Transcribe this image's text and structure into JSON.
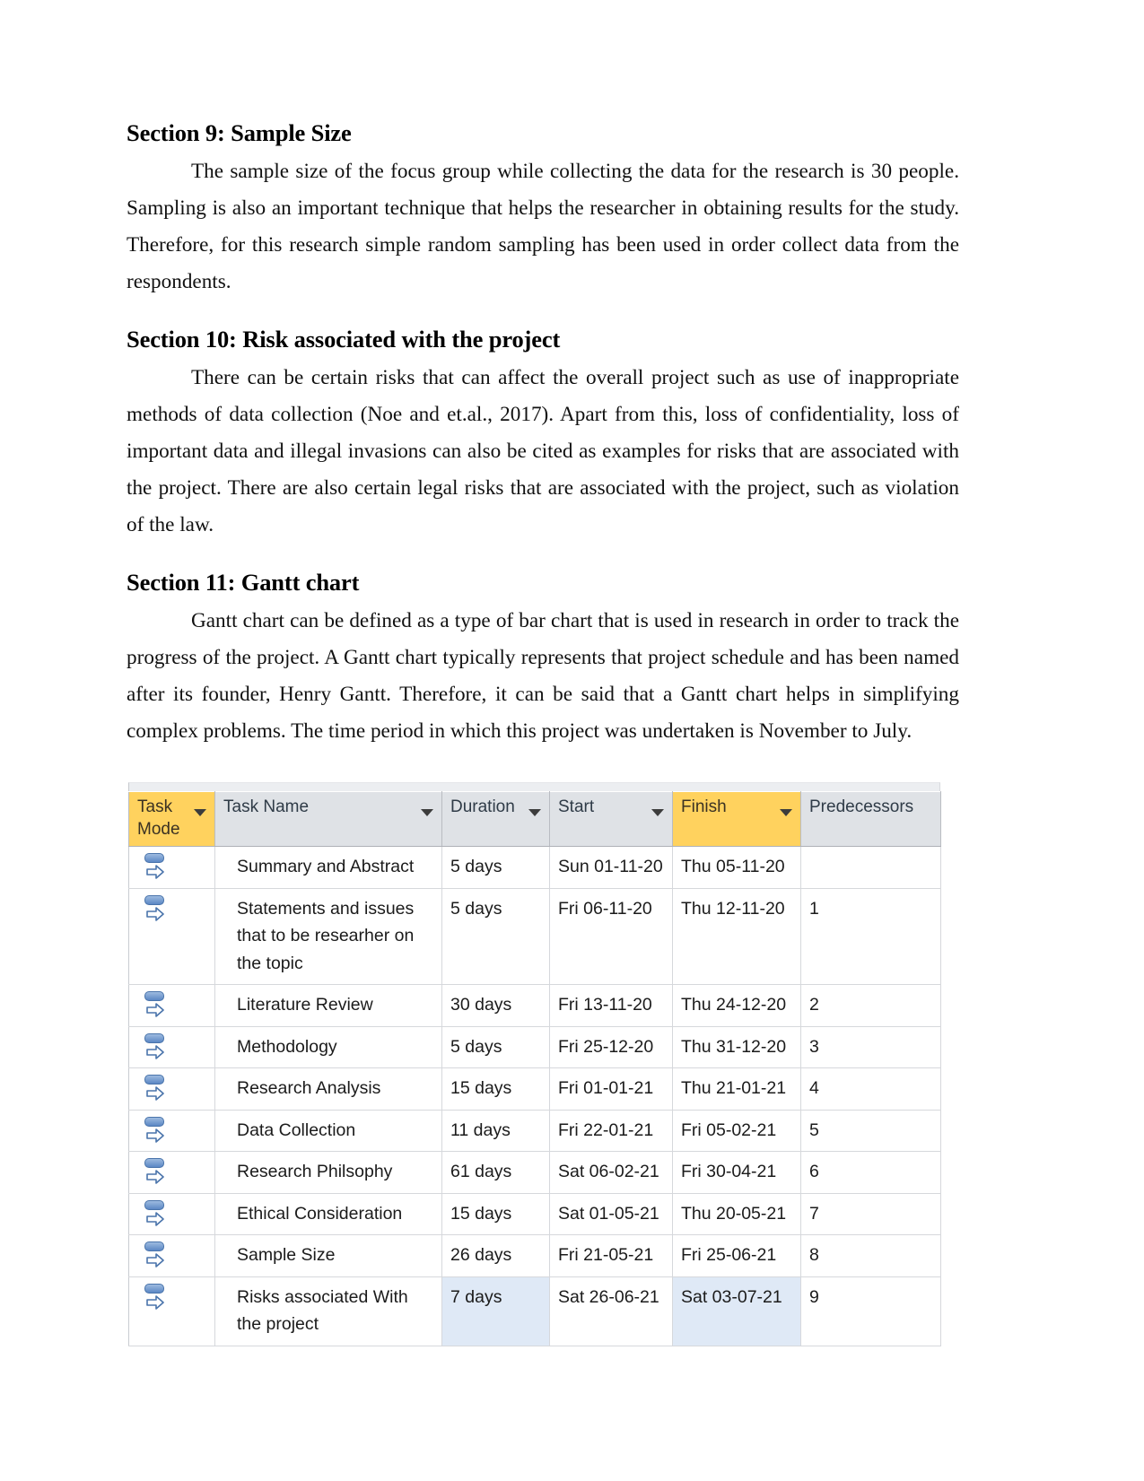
{
  "document": {
    "sections": [
      {
        "heading": "Section 9: Sample Size",
        "paragraph": "The sample size of the focus group while collecting the data for the research is 30 people. Sampling is also an important technique that helps the researcher in obtaining results for the study. Therefore, for this research simple random sampling has been used in order collect data from the respondents."
      },
      {
        "heading": "Section 10: Risk associated with the project",
        "paragraph": "There can be certain risks that can affect the overall project such as use of inappropriate methods of data collection (Noe and et.al., 2017). Apart from this, loss of confidentiality, loss of important data and illegal invasions can also be cited as examples for risks that are associated with the project. There are also certain legal risks that are associated with the project, such as violation of the law."
      },
      {
        "heading": "Section 11: Gantt chart",
        "paragraph": "Gantt chart can be defined as a type of bar chart that is used in research in order to track the progress of the project. A Gantt chart typically represents that project schedule and has been named after its founder, Henry Gantt. Therefore, it can be said that a Gantt chart helps in simplifying complex problems. The time period in which this project was undertaken is November to July."
      }
    ]
  },
  "gantt_table": {
    "columns": [
      {
        "label": "Task Mode",
        "key": "task_mode",
        "highlight": "#ffd25e",
        "filter_icon": "chevron-down-icon"
      },
      {
        "label": "Task Name",
        "key": "task_name",
        "highlight": "#dfe2e6",
        "filter_icon": "chevron-down-icon"
      },
      {
        "label": "Duration",
        "key": "duration",
        "highlight": "#dfe2e6",
        "filter_icon": "chevron-down-icon"
      },
      {
        "label": "Start",
        "key": "start",
        "highlight": "#dfe2e6",
        "filter_icon": "chevron-down-icon"
      },
      {
        "label": "Finish",
        "key": "finish",
        "highlight": "#ffd25e",
        "filter_icon": "chevron-down-icon"
      },
      {
        "label": "Predecessors",
        "key": "predecessors",
        "highlight": "#dfe2e6",
        "filter_icon": null
      }
    ],
    "task_mode_icon": "manually-scheduled-icon",
    "selection_color": "#dfe9f6",
    "rows": [
      {
        "task_mode": "",
        "task_name": "Summary and Abstract",
        "duration": "5 days",
        "start": "Sun 01-11-20",
        "finish": "Thu 05-11-20",
        "predecessors": "",
        "selected": []
      },
      {
        "task_mode": "",
        "task_name": "Statements and issues that to be researher on the topic",
        "duration": "5 days",
        "start": "Fri 06-11-20",
        "finish": "Thu 12-11-20",
        "predecessors": "1",
        "selected": []
      },
      {
        "task_mode": "",
        "task_name": "Literature Review",
        "duration": "30 days",
        "start": "Fri 13-11-20",
        "finish": "Thu 24-12-20",
        "predecessors": "2",
        "selected": []
      },
      {
        "task_mode": "",
        "task_name": "Methodology",
        "duration": "5 days",
        "start": "Fri 25-12-20",
        "finish": "Thu 31-12-20",
        "predecessors": "3",
        "selected": []
      },
      {
        "task_mode": "",
        "task_name": "Research Analysis",
        "duration": "15 days",
        "start": "Fri 01-01-21",
        "finish": "Thu 21-01-21",
        "predecessors": "4",
        "selected": []
      },
      {
        "task_mode": "",
        "task_name": "Data Collection",
        "duration": "11 days",
        "start": "Fri 22-01-21",
        "finish": "Fri 05-02-21",
        "predecessors": "5",
        "selected": []
      },
      {
        "task_mode": "",
        "task_name": "Research Philsophy",
        "duration": "61 days",
        "start": "Sat 06-02-21",
        "finish": "Fri 30-04-21",
        "predecessors": "6",
        "selected": []
      },
      {
        "task_mode": "",
        "task_name": "Ethical Consideration",
        "duration": "15 days",
        "start": "Sat 01-05-21",
        "finish": "Thu 20-05-21",
        "predecessors": "7",
        "selected": []
      },
      {
        "task_mode": "",
        "task_name": "Sample Size",
        "duration": "26 days",
        "start": "Fri 21-05-21",
        "finish": "Fri 25-06-21",
        "predecessors": "8",
        "selected": []
      },
      {
        "task_mode": "",
        "task_name": "Risks associated With the project",
        "duration": "7 days",
        "start": "Sat 26-06-21",
        "finish": "Sat 03-07-21",
        "predecessors": "9",
        "selected": [
          "duration",
          "finish"
        ]
      }
    ]
  }
}
